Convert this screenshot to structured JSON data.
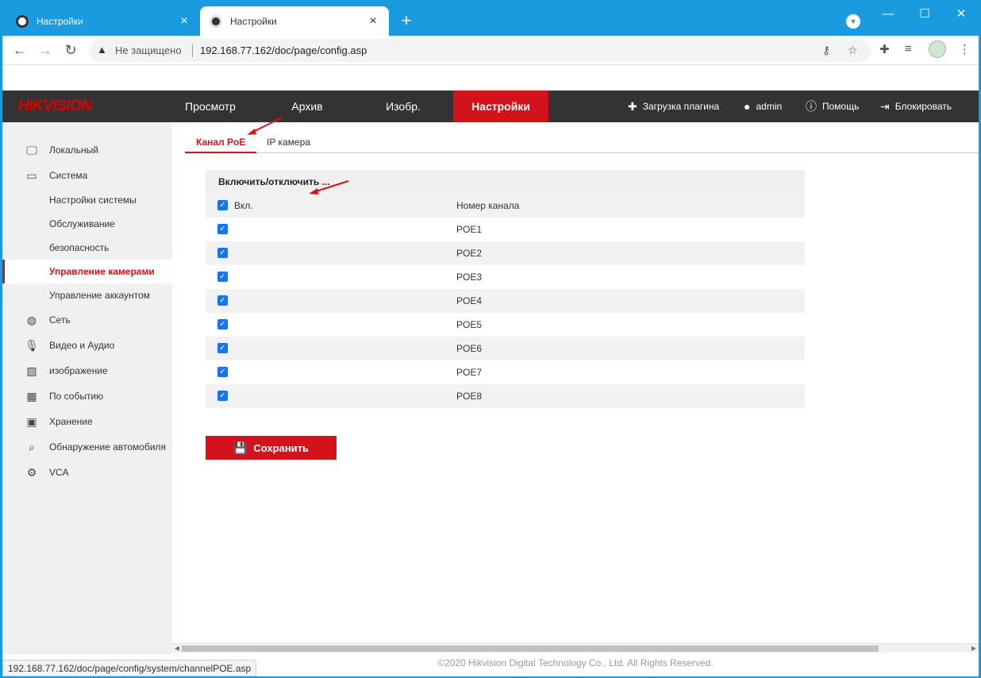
{
  "browser": {
    "tabs": [
      {
        "title": "Настройки",
        "active": false
      },
      {
        "title": "Настройки",
        "active": true
      }
    ],
    "new_tab": "+",
    "not_secure": "Не защищено",
    "url": "192.168.77.162/doc/page/config.asp",
    "status_url": "192.168.77.162/doc/page/config/system/channelPOE.asp"
  },
  "header": {
    "logo": "HIKVISION",
    "nav": [
      "Просмотр",
      "Архив",
      "Изобр.",
      "Настройки"
    ],
    "plugin": "Загрузка плагина",
    "user": "admin",
    "help": "Помощь",
    "logout": "Блокировать"
  },
  "sidebar": {
    "items": [
      {
        "label": "Локальный",
        "icon": "monitor-icon"
      },
      {
        "label": "Система",
        "icon": "window-icon"
      },
      {
        "label": "Настройки системы"
      },
      {
        "label": "Обслуживание"
      },
      {
        "label": "безопасность"
      },
      {
        "label": "Управление камерами",
        "active": true
      },
      {
        "label": "Управление аккаунтом"
      },
      {
        "label": "Сеть",
        "icon": "globe-icon"
      },
      {
        "label": "Видео и Аудио",
        "icon": "mic-icon"
      },
      {
        "label": "изображение",
        "icon": "image-icon"
      },
      {
        "label": "По событию",
        "icon": "calendar-icon"
      },
      {
        "label": "Хранение",
        "icon": "floppy-icon"
      },
      {
        "label": "Обнаружение автомобиля",
        "icon": "car-search-icon"
      },
      {
        "label": "VCA",
        "icon": "vca-icon"
      }
    ]
  },
  "subtabs": [
    "Канал PoE",
    "IP камера"
  ],
  "table": {
    "title": "Включить/отключить ...",
    "col_enable": "Вкл.",
    "col_channel": "Номер канала",
    "rows": [
      "POE1",
      "POE2",
      "POE3",
      "POE4",
      "POE5",
      "POE6",
      "POE7",
      "POE8"
    ]
  },
  "save_label": "Сохранить",
  "footer": "©2020 Hikvision Digital Technology Co., Ltd. All Rights Reserved.",
  "colors": {
    "accent": "#d3131b",
    "chrome": "#1a9be0",
    "header": "#333333",
    "checkbox": "#1a73e8"
  }
}
